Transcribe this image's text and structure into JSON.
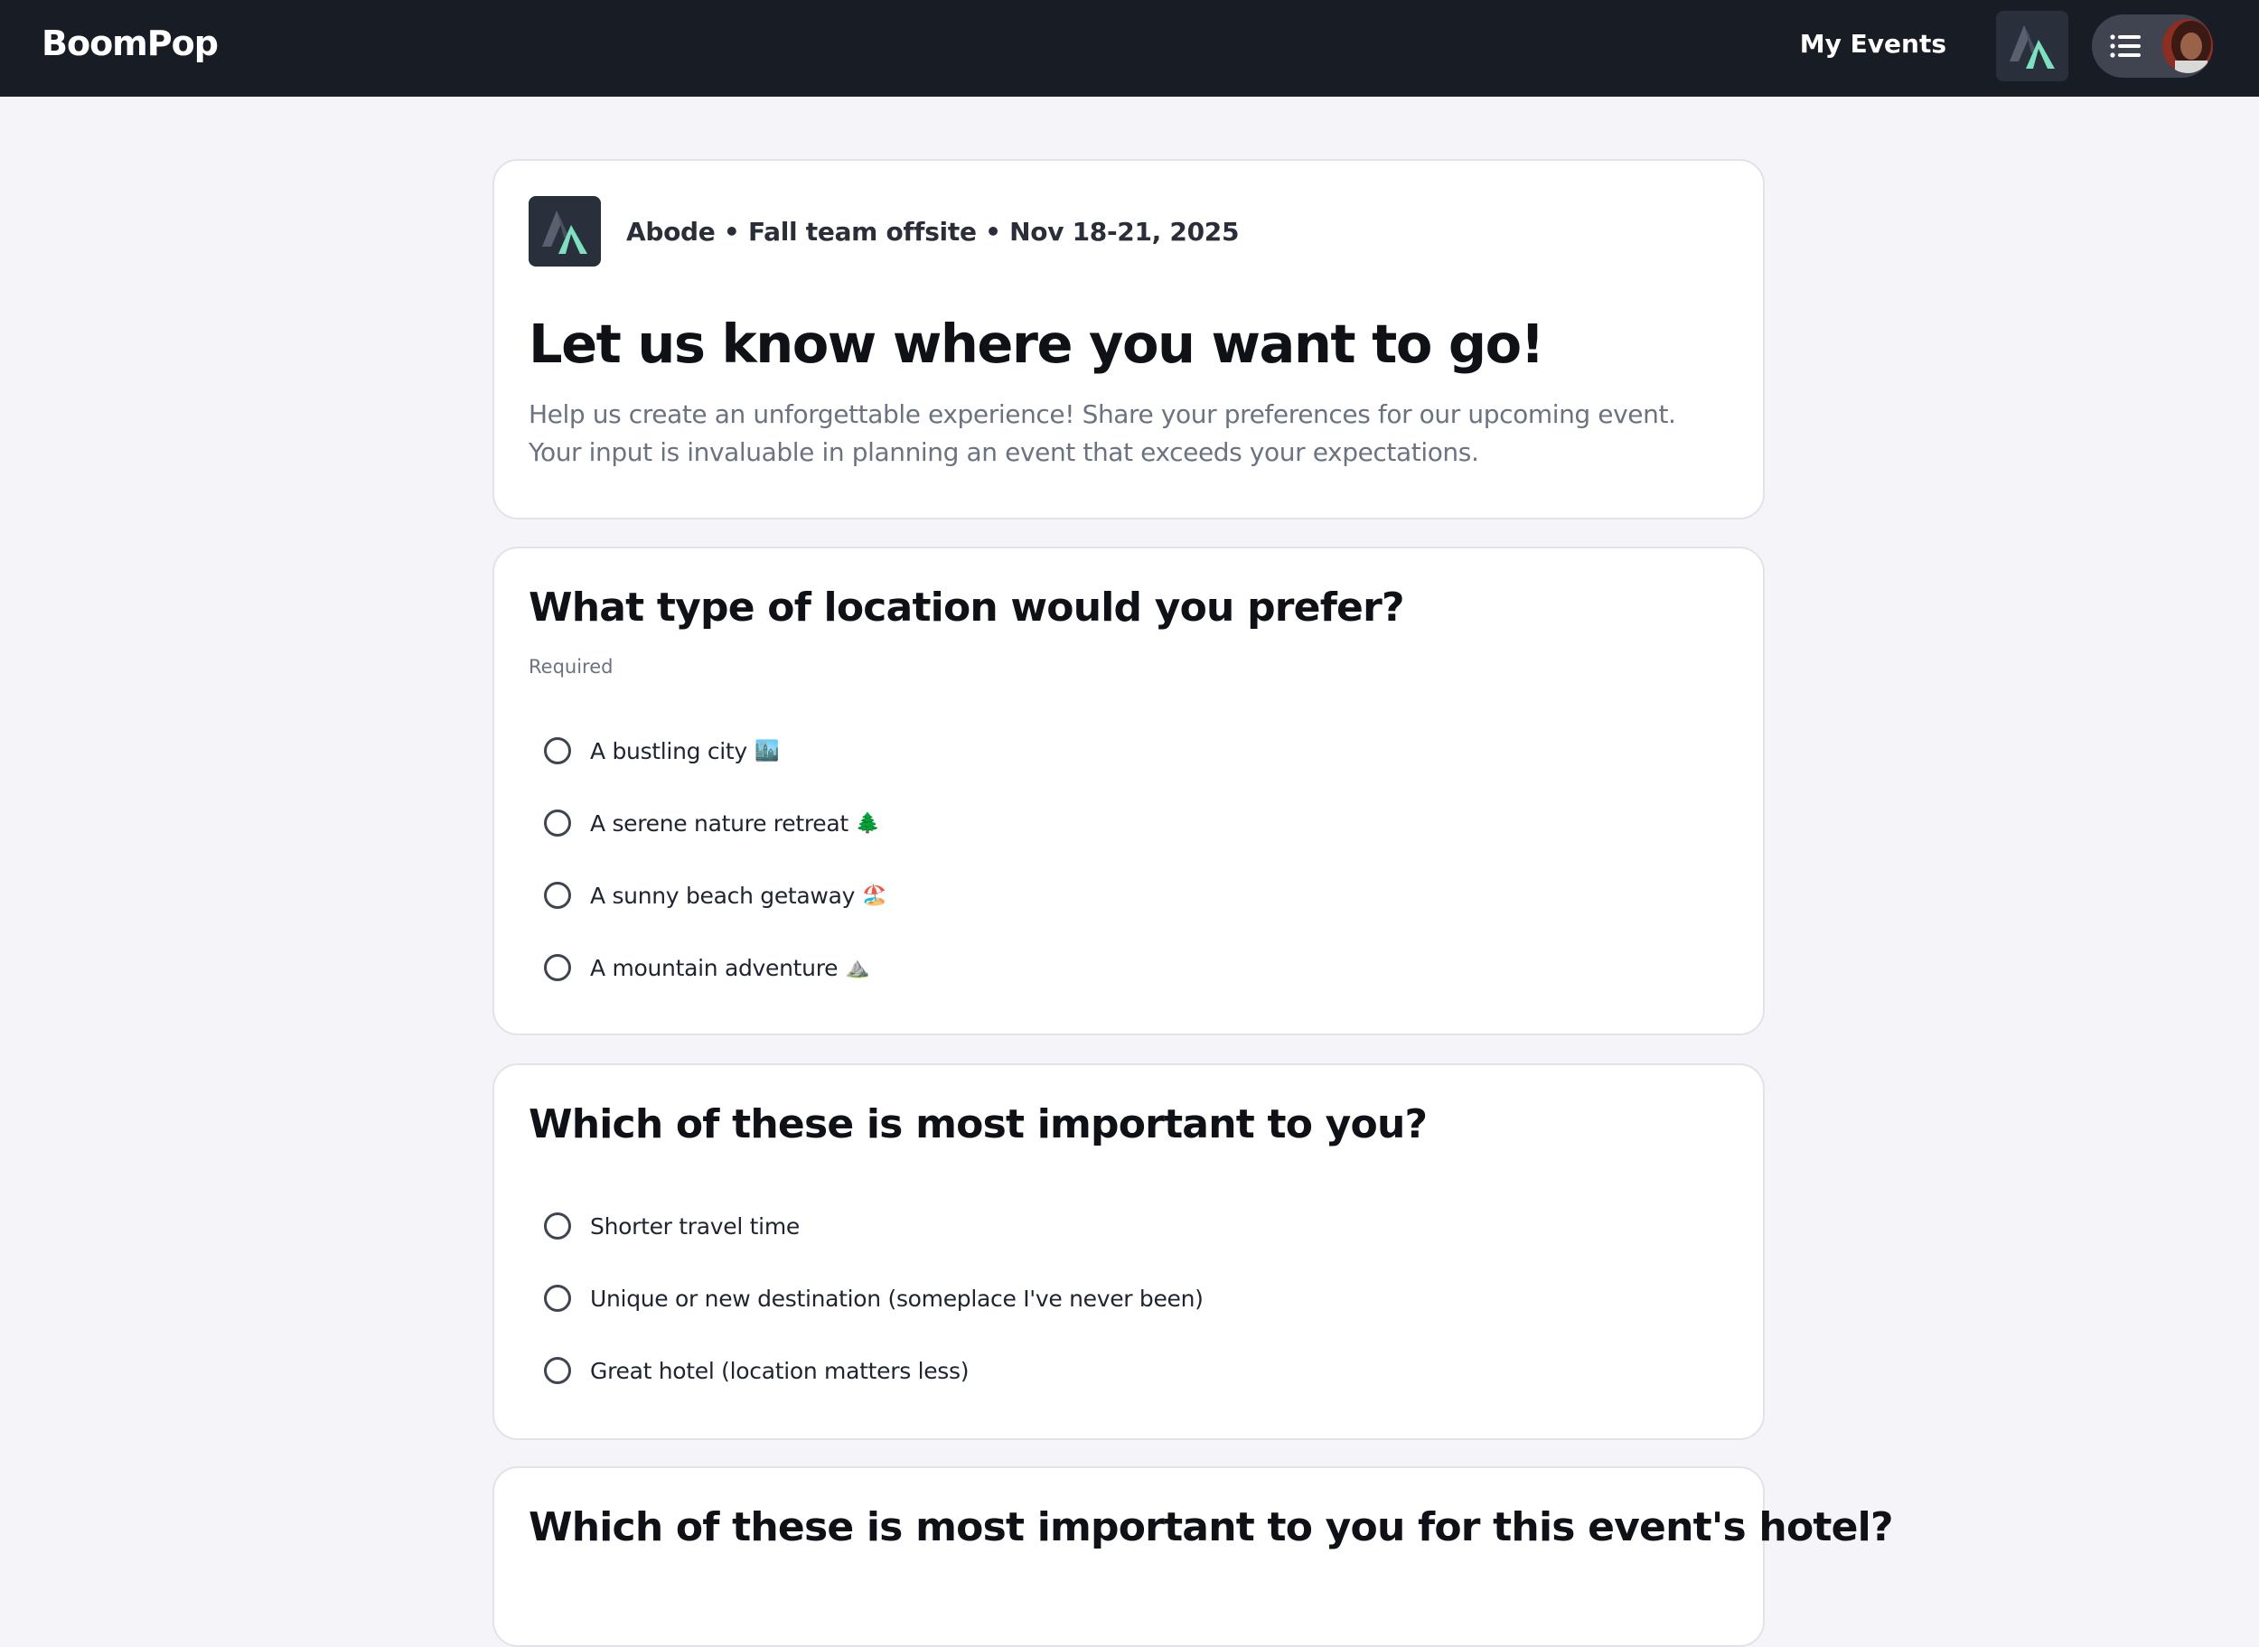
{
  "header": {
    "brand": "BoomPop",
    "nav_my_events": "My Events"
  },
  "intro": {
    "event_meta": "Abode • Fall team offsite • Nov 18-21, 2025",
    "title": "Let us know where you want to go!",
    "description": "Help us create an unforgettable experience! Share your preferences for our upcoming event. Your input is invaluable in planning an event that exceeds your expectations."
  },
  "questions": [
    {
      "title": "What type of location would you prefer?",
      "required_label": "Required",
      "options": [
        {
          "label": "A bustling city",
          "emoji": "🏙️"
        },
        {
          "label": "A serene nature retreat",
          "emoji": "🌲"
        },
        {
          "label": "A sunny beach getaway",
          "emoji": "🏖️"
        },
        {
          "label": "A mountain adventure",
          "emoji": "⛰️"
        }
      ]
    },
    {
      "title": "Which of these is most important to you?",
      "options": [
        {
          "label": "Shorter travel time"
        },
        {
          "label": "Unique or new destination (someplace I've never been)"
        },
        {
          "label": "Great hotel (location matters less)"
        }
      ]
    },
    {
      "title": "Which of these is most important to you for this event's hotel?"
    }
  ],
  "colors": {
    "topbar": "#181c25",
    "page_bg": "#f4f4f9",
    "logo_accent": "#7ee0c0"
  },
  "icons": {
    "org_logo": "abode-peak-logo",
    "menu": "hamburger-icon",
    "radio": "radio-unchecked"
  }
}
